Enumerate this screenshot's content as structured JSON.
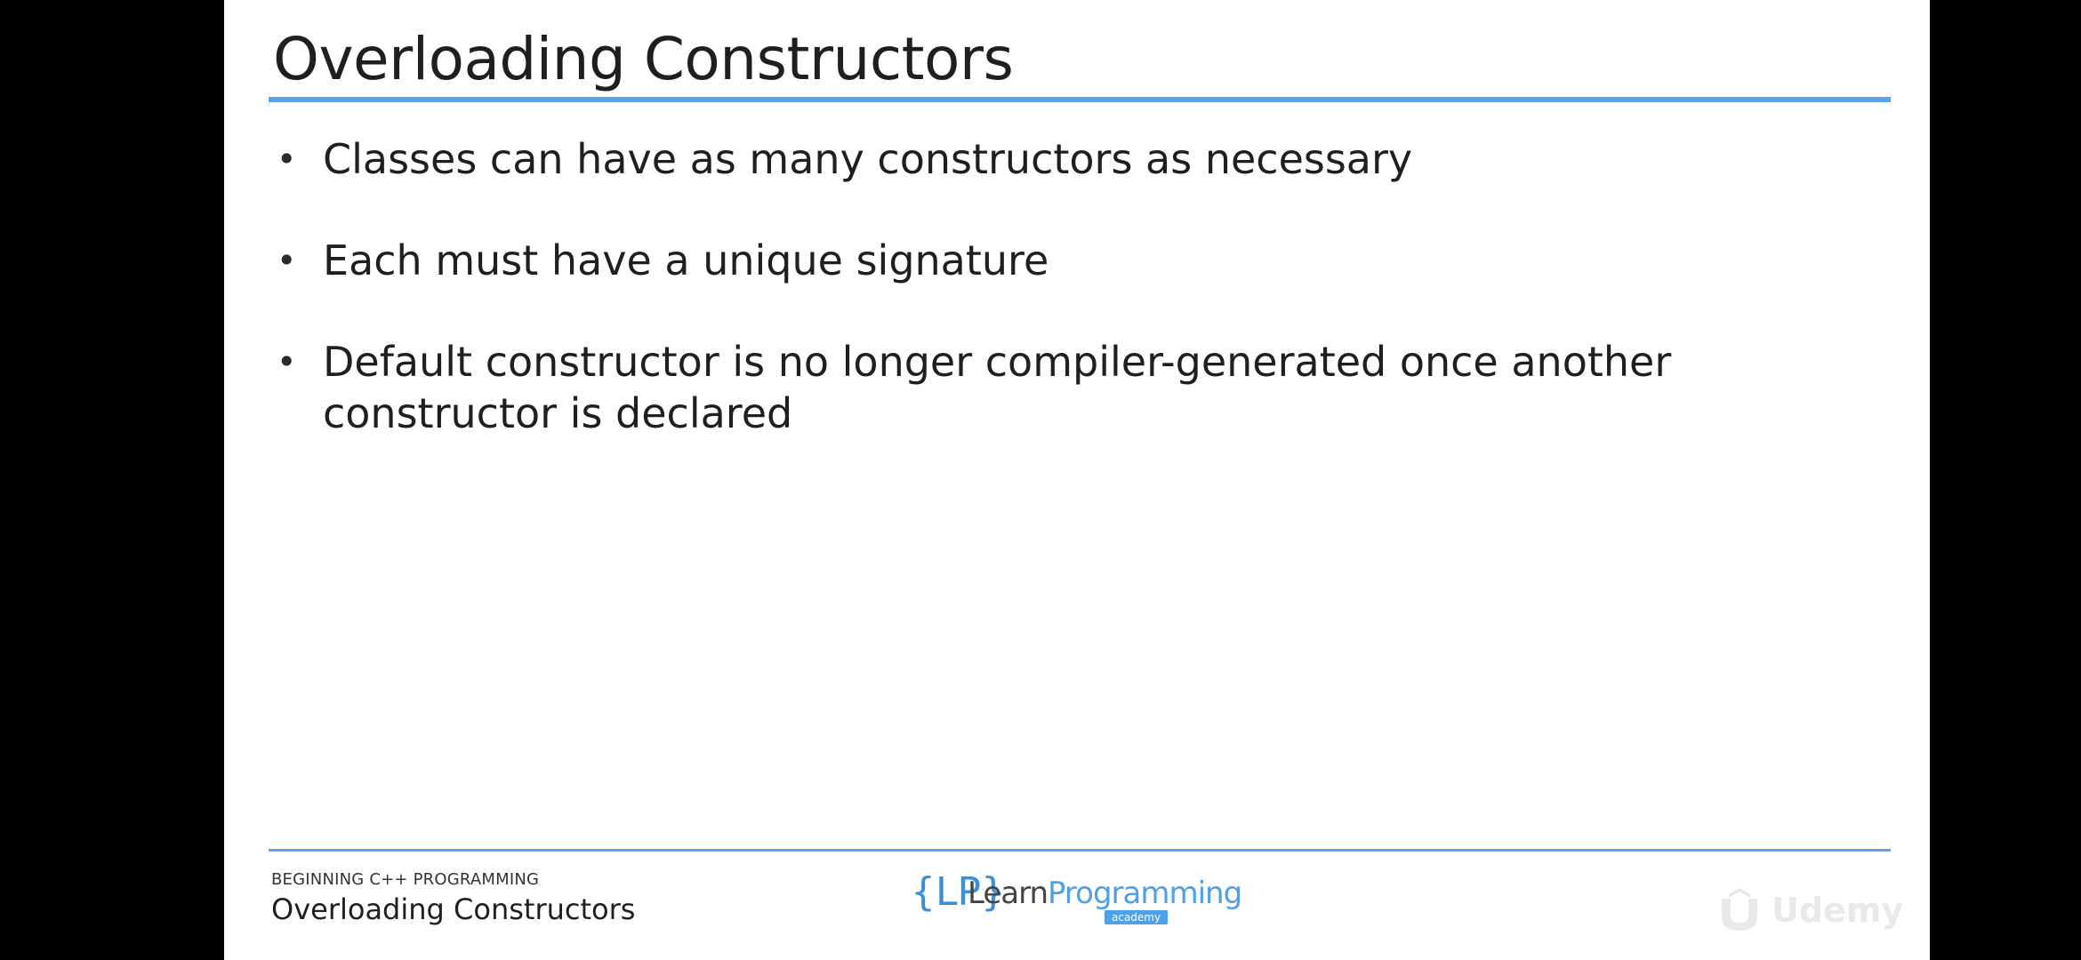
{
  "slide": {
    "title": "Overloading Constructors",
    "bullets": [
      {
        "marker": "•",
        "text": "Classes can have as many constructors as necessary"
      },
      {
        "marker": "•",
        "text": "Each must have a unique signature"
      },
      {
        "marker": "•",
        "text": "Default constructor is no longer compiler-generated once another constructor is declared"
      }
    ]
  },
  "footer": {
    "course": "BEGINNING C++ PROGRAMMING",
    "lesson": "Overloading Constructors",
    "brand": {
      "mark": "{LP}",
      "learn": "Learn",
      "programming": "Programming",
      "academy": "academy"
    },
    "watermark": {
      "icon": "udemy-logo-icon",
      "text": "Udemy"
    }
  },
  "colors": {
    "accent": "#5aa4ea",
    "text": "#1f1f1f",
    "background": "#ffffff",
    "letterbox": "#000000"
  }
}
